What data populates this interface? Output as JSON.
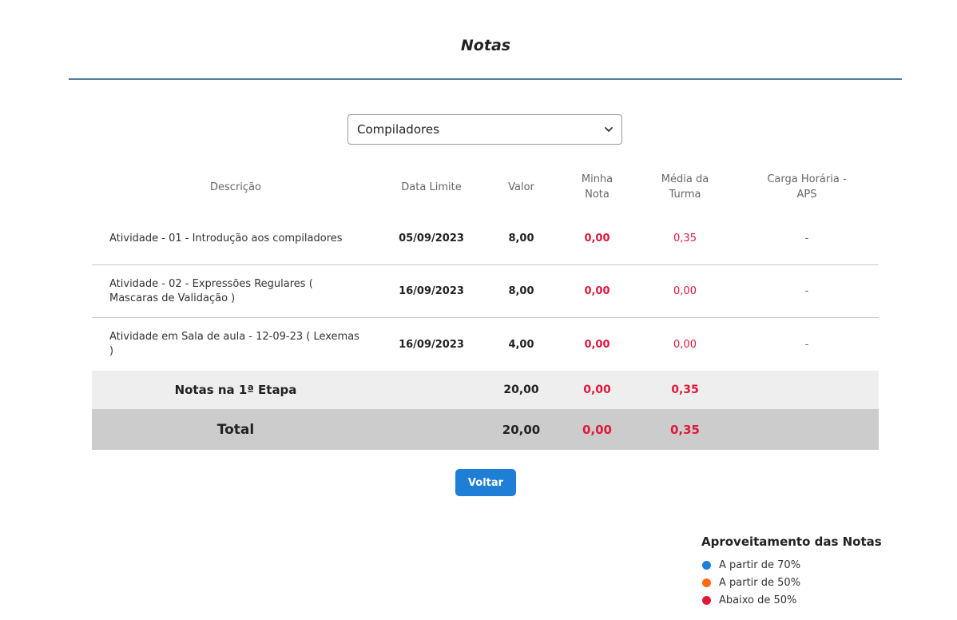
{
  "page": {
    "title": "Notas"
  },
  "subject_select": {
    "value": "Compiladores"
  },
  "table": {
    "headers": {
      "description": "Descrição",
      "due_date": "Data Limite",
      "value": "Valor",
      "my_grade": "Minha Nota",
      "class_avg": "Média da Turma",
      "workload": "Carga Horária - APS"
    },
    "rows": [
      {
        "description": "Atividade - 01 - Introdução aos compiladores",
        "due_date": "05/09/2023",
        "value": "8,00",
        "my_grade": "0,00",
        "class_avg": "0,35",
        "workload": "-"
      },
      {
        "description": "Atividade - 02 - Expressões Regulares ( Mascaras de Validação )",
        "due_date": "16/09/2023",
        "value": "8,00",
        "my_grade": "0,00",
        "class_avg": "0,00",
        "workload": "-"
      },
      {
        "description": "Atividade em Sala de aula - 12-09-23 ( Lexemas )",
        "due_date": "16/09/2023",
        "value": "4,00",
        "my_grade": "0,00",
        "class_avg": "0,00",
        "workload": "-"
      }
    ],
    "stage": {
      "label": "Notas na 1ª Etapa",
      "value": "20,00",
      "my_grade": "0,00",
      "class_avg": "0,35"
    },
    "total": {
      "label": "Total",
      "value": "20,00",
      "my_grade": "0,00",
      "class_avg": "0,35"
    }
  },
  "back_button": {
    "label": "Voltar"
  },
  "legend": {
    "title": "Aproveitamento das Notas",
    "items": [
      {
        "label": "A partir de 70%",
        "color": "#1f7fd6"
      },
      {
        "label": "A partir de 50%",
        "color": "#ff6a13"
      },
      {
        "label": "Abaixo de 50%",
        "color": "#e0183a"
      }
    ]
  },
  "colors": {
    "accent": "#1f7fd6",
    "grade_red": "#e0183a"
  }
}
